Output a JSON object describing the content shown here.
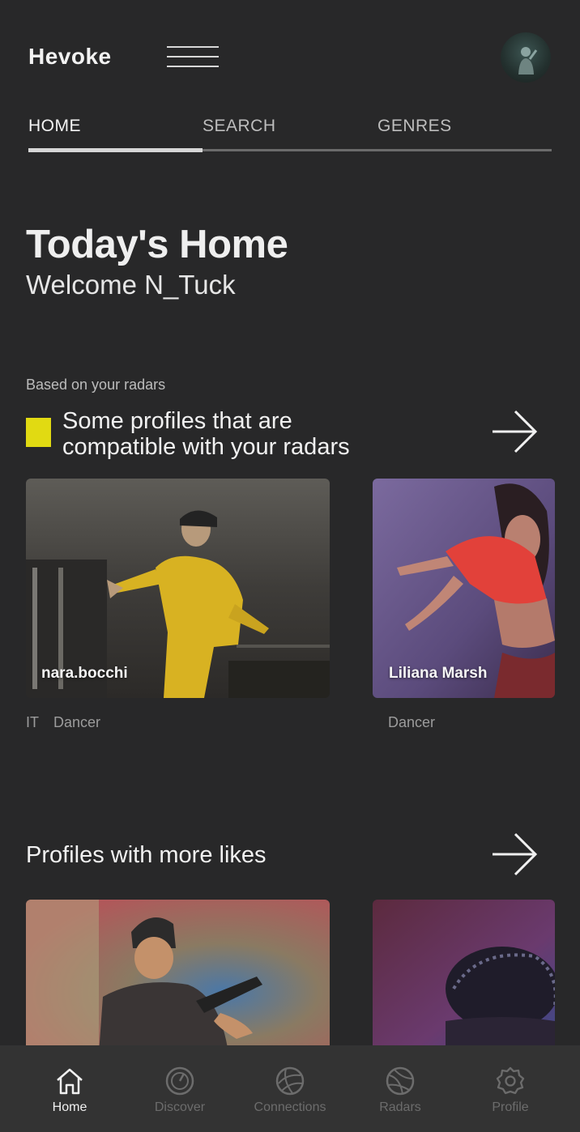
{
  "header": {
    "app_name": "Hevoke",
    "menu_icon": "hamburger-icon",
    "avatar": "user-avatar"
  },
  "tabs": [
    {
      "label": "HOME",
      "active": true
    },
    {
      "label": "SEARCH",
      "active": false
    },
    {
      "label": "GENRES",
      "active": false
    }
  ],
  "page": {
    "title": "Today's Home",
    "welcome": "Welcome N_Tuck"
  },
  "section_radars": {
    "kicker": "Based on your radars",
    "title_line1": "Some profiles that are",
    "title_line2": "compatible with your radars",
    "arrow_icon": "arrow-right-icon",
    "accent_color": "#e1da12",
    "cards": [
      {
        "name": "nara.bocchi",
        "tag1": "IT",
        "tag2": "Dancer"
      },
      {
        "name": "Liliana Marsh",
        "tag1": "",
        "tag2": "Dancer"
      }
    ]
  },
  "section_likes": {
    "title": "Profiles with more likes",
    "arrow_icon": "arrow-right-icon"
  },
  "bottom_nav": [
    {
      "label": "Home",
      "icon": "home-icon",
      "active": true
    },
    {
      "label": "Discover",
      "icon": "discover-icon",
      "active": false
    },
    {
      "label": "Connections",
      "icon": "connections-icon",
      "active": false
    },
    {
      "label": "Radars",
      "icon": "radar-icon",
      "active": false
    },
    {
      "label": "Profile",
      "icon": "gear-icon",
      "active": false
    }
  ]
}
